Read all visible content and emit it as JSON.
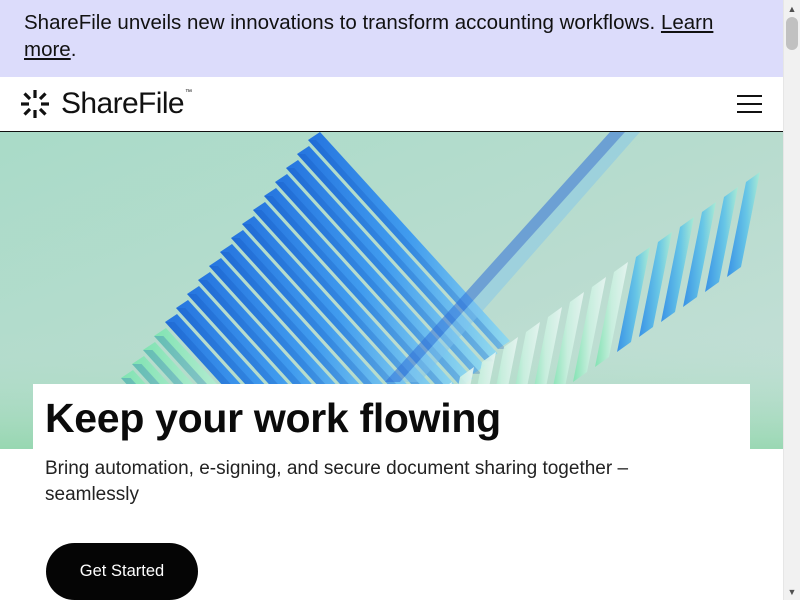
{
  "banner": {
    "text": "ShareFile unveils new innovations to transform accounting workflows. ",
    "link": "Learn more",
    "suffix": "."
  },
  "header": {
    "logo_text": "ShareFile",
    "logo_tm": "™",
    "menu_icon": "hamburger-menu-icon"
  },
  "hero": {
    "title": "Keep your work flowing",
    "subtitle": "Bring automation, e-signing, and secure document sharing together – seamlessly",
    "cta_label": "Get Started"
  },
  "scrollbar": {
    "up_icon": "▲",
    "down_icon": "▼"
  },
  "colors": {
    "banner_bg": "#dcdcfb",
    "cta_bg": "#050505",
    "hero_blue": "#1f7ae6",
    "hero_green": "#8cdca8"
  }
}
